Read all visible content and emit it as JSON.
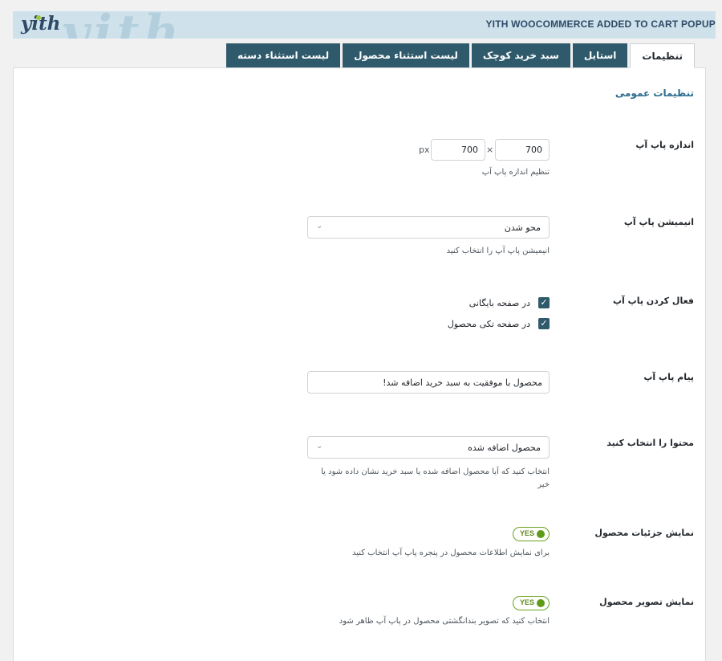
{
  "banner": {
    "logo": "yith",
    "title": "YITH WOOCOMMERCE ADDED TO CART POPUP"
  },
  "tabs": [
    {
      "label": "تنظیمات",
      "active": true
    },
    {
      "label": "استایل",
      "active": false
    },
    {
      "label": "سبد خرید کوچک",
      "active": false
    },
    {
      "label": "لیست استثناء محصول",
      "active": false
    },
    {
      "label": "لیست استثناء دسته",
      "active": false
    }
  ],
  "section": {
    "title": "تنظیمات عمومی"
  },
  "popup_size": {
    "label": "اندازه پاپ آپ",
    "width": "700",
    "height": "700",
    "separator": "×",
    "unit": "px",
    "desc": "تنظیم اندازه پاپ آپ"
  },
  "popup_animation": {
    "label": "انیمیشن پاپ آپ",
    "value": "محو شدن",
    "desc": "انیمیشن پاپ آپ را انتخاب کنید"
  },
  "enable_popup": {
    "label": "فعال کردن پاپ آپ",
    "options": [
      "در صفحه بایگانی",
      "در صفحه تکی محصول"
    ]
  },
  "popup_message": {
    "label": "پیام پاپ آپ",
    "value": "محصول با موفقیت به سبد خرید اضافه شد!"
  },
  "content_select": {
    "label": "محتوا را انتخاب کنید",
    "value": "محصول اضافه شده",
    "desc": "انتخاب کنید که آیا محصول اضافه شده یا سبد خرید نشان داده شود یا خیر"
  },
  "show_details": {
    "label": "نمایش جزئیات محصول",
    "toggle": "YES",
    "desc": "برای نمایش اطلاعات محصول در پنجره پاپ آپ انتخاب کنید"
  },
  "show_image": {
    "label": "نمایش تصویر محصول",
    "toggle": "YES",
    "desc": "انتخاب کنید که تصویر بندانگشتی محصول در پاپ آپ ظاهر شود"
  },
  "colors": {
    "accent": "#2f5a6b",
    "link": "#2c6b8f",
    "toggle_on": "#5e9c18"
  }
}
